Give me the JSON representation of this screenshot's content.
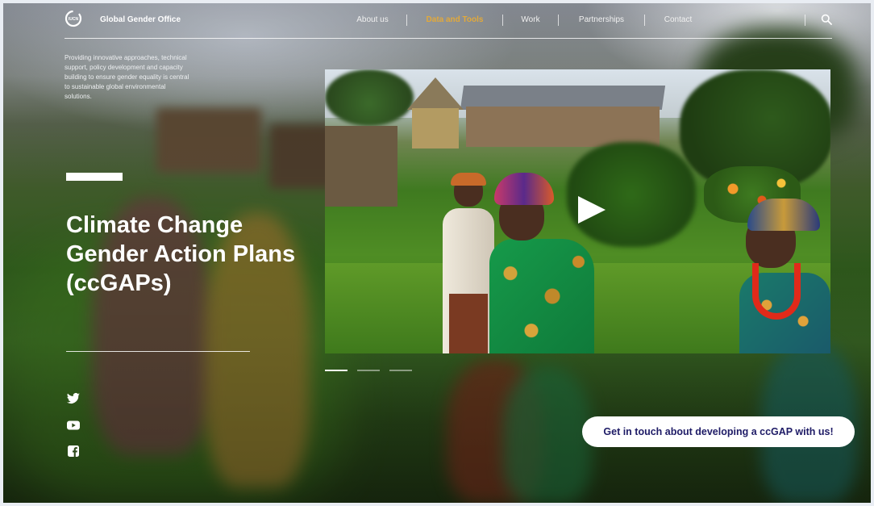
{
  "header": {
    "brand": "Global Gender Office",
    "logo_text": "IUCN",
    "nav": [
      {
        "label": "About us",
        "active": false
      },
      {
        "label": "Data and Tools",
        "active": true
      },
      {
        "label": "Work",
        "active": false
      },
      {
        "label": "Partnerships",
        "active": false
      },
      {
        "label": "Contact",
        "active": false
      }
    ],
    "search_icon": "search-icon",
    "active_color": "#e2a93a"
  },
  "hero": {
    "tagline": "Providing innovative approaches, technical support, policy development and capacity building to ensure gender equality is central to sustainable global environmental solutions.",
    "title_lines": [
      "Climate Change",
      "Gender Action Plans",
      "(ccGAPs)"
    ]
  },
  "social": [
    "twitter-icon",
    "youtube-icon",
    "facebook-icon"
  ],
  "carousel": {
    "slides": 3,
    "active_index": 0
  },
  "cta": {
    "label": "Get in touch about developing a ccGAP with us!",
    "text_color": "#1e1b66"
  }
}
